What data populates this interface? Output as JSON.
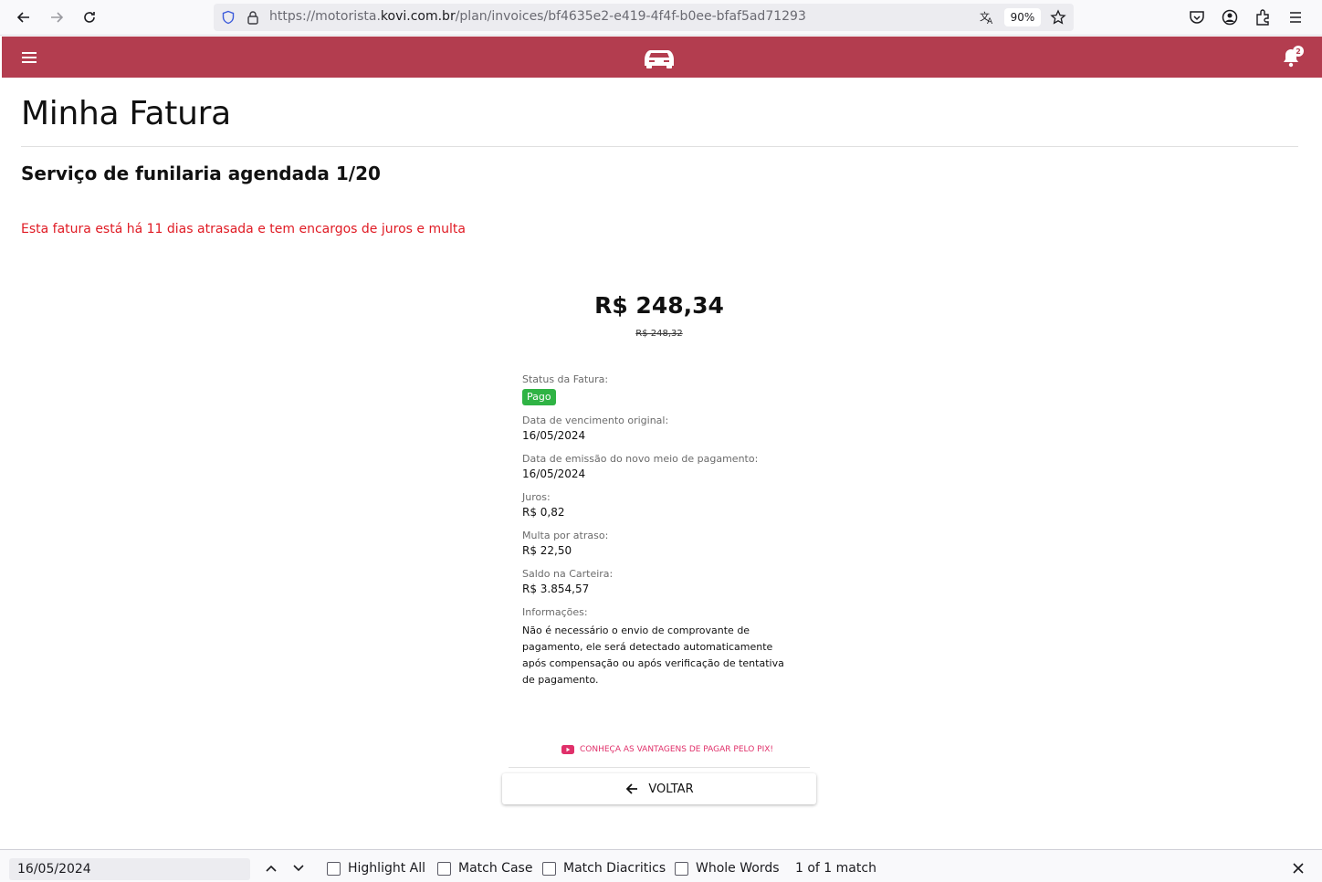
{
  "browser": {
    "url_prefix": "https://motorista.",
    "url_host": "kovi.com.br",
    "url_path": "/plan/invoices/bf4635e2-e419-4f4f-b0ee-bfaf5ad71293",
    "zoom": "90%"
  },
  "header": {
    "notifications_count": "2",
    "brand_color": "#b33d4f"
  },
  "page": {
    "title": "Minha Fatura",
    "subtitle": "Serviço de funilaria agendada 1/20",
    "overdue_alert": "Esta fatura está há 11 dias atrasada e tem encargos de juros e multa",
    "amount": "R$ 248,34",
    "old_amount": "R$ 248,32"
  },
  "details": {
    "status_label": "Status da Fatura:",
    "status_value": "Pago",
    "due_label": "Data de vencimento original:",
    "due_value": "16/05/2024",
    "issue_label": "Data de emissão do novo meio de pagamento:",
    "issue_value": "16/05/2024",
    "interest_label": "Juros:",
    "interest_value": "R$ 0,82",
    "fine_label": "Multa por atraso:",
    "fine_value": "R$ 22,50",
    "wallet_label": "Saldo na Carteira:",
    "wallet_value": "R$ 3.854,57",
    "info_label": "Informações:",
    "info_text": "Não é necessário o envio de comprovante de pagamento, ele será detectado automaticamente após compensação ou após verificação de tentativa de pagamento."
  },
  "actions": {
    "pix_link": "CONHEÇA AS VANTAGENS DE PAGAR PELO PIX!",
    "back_label": "VOLTAR"
  },
  "findbar": {
    "query": "16/05/2024",
    "highlight_all": "Highlight All",
    "match_case": "Match Case",
    "match_diacritics": "Match Diacritics",
    "whole_words": "Whole Words",
    "result": "1 of 1 match"
  }
}
